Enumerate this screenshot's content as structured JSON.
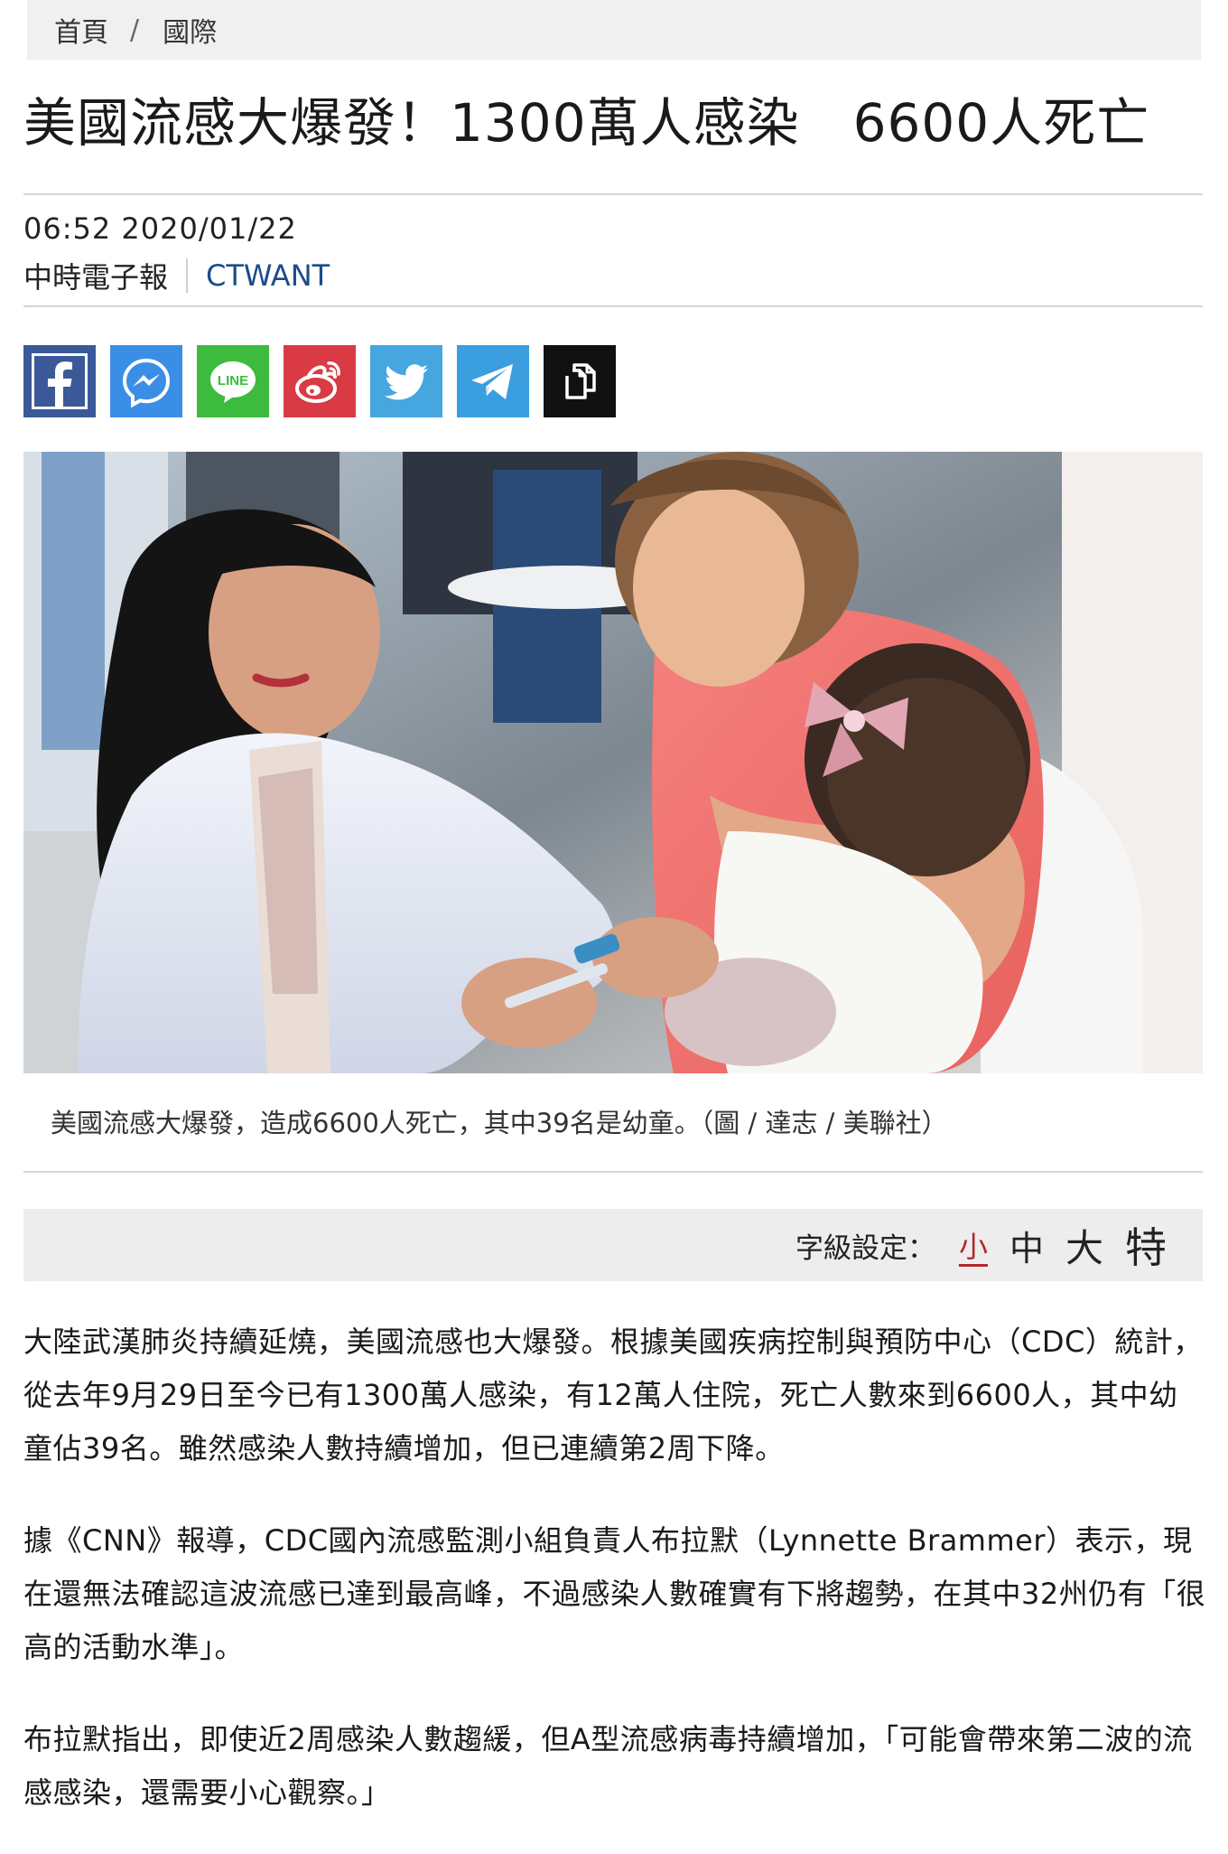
{
  "breadcrumb": {
    "home": "首頁",
    "separator": "/",
    "section": "國際"
  },
  "article": {
    "title": "美國流感大爆發！1300萬人感染　6600人死亡",
    "time": "06:52  2020/01/22",
    "source": "中時電子報",
    "brand": "CTWANT",
    "image_alt": "疫苗接種照片",
    "caption": "美國流感大爆發，造成6600人死亡，其中39名是幼童。（圖 / 達志 / 美聯社）",
    "paragraphs": [
      "大陸武漢肺炎持續延燒，美國流感也大爆發。根據美國疾病控制與預防中心（CDC）統計，從去年9月29日至今已有1300萬人感染，有12萬人住院，死亡人數來到6600人，其中幼童佔39名。雖然感染人數持續增加，但已連續第2周下降。",
      "據《CNN》報導，CDC國內流感監測小組負責人布拉默（Lynnette Brammer）表示，現在還無法確認這波流感已達到最高峰，不過感染人數確實有下將趨勢，在其中32州仍有「很高的活動水準」。",
      "布拉默指出，即使近2周感染人數趨緩，但A型流感病毒持續增加，「可能會帶來第二波的流感感染，還需要小心觀察。」"
    ]
  },
  "share": {
    "buttons": [
      {
        "name": "facebook-icon",
        "color": "#3b5998"
      },
      {
        "name": "messenger-icon",
        "color": "#3b8ee6"
      },
      {
        "name": "line-icon",
        "color": "#3dbb3d",
        "label": "LINE"
      },
      {
        "name": "weibo-icon",
        "color": "#d93a43"
      },
      {
        "name": "twitter-icon",
        "color": "#45a6e0"
      },
      {
        "name": "telegram-icon",
        "color": "#3b9ede"
      },
      {
        "name": "copy-link-icon",
        "color": "#111111"
      }
    ]
  },
  "font_size": {
    "label": "字級設定：",
    "options": [
      "小",
      "中",
      "大",
      "特"
    ],
    "selected": "小"
  }
}
